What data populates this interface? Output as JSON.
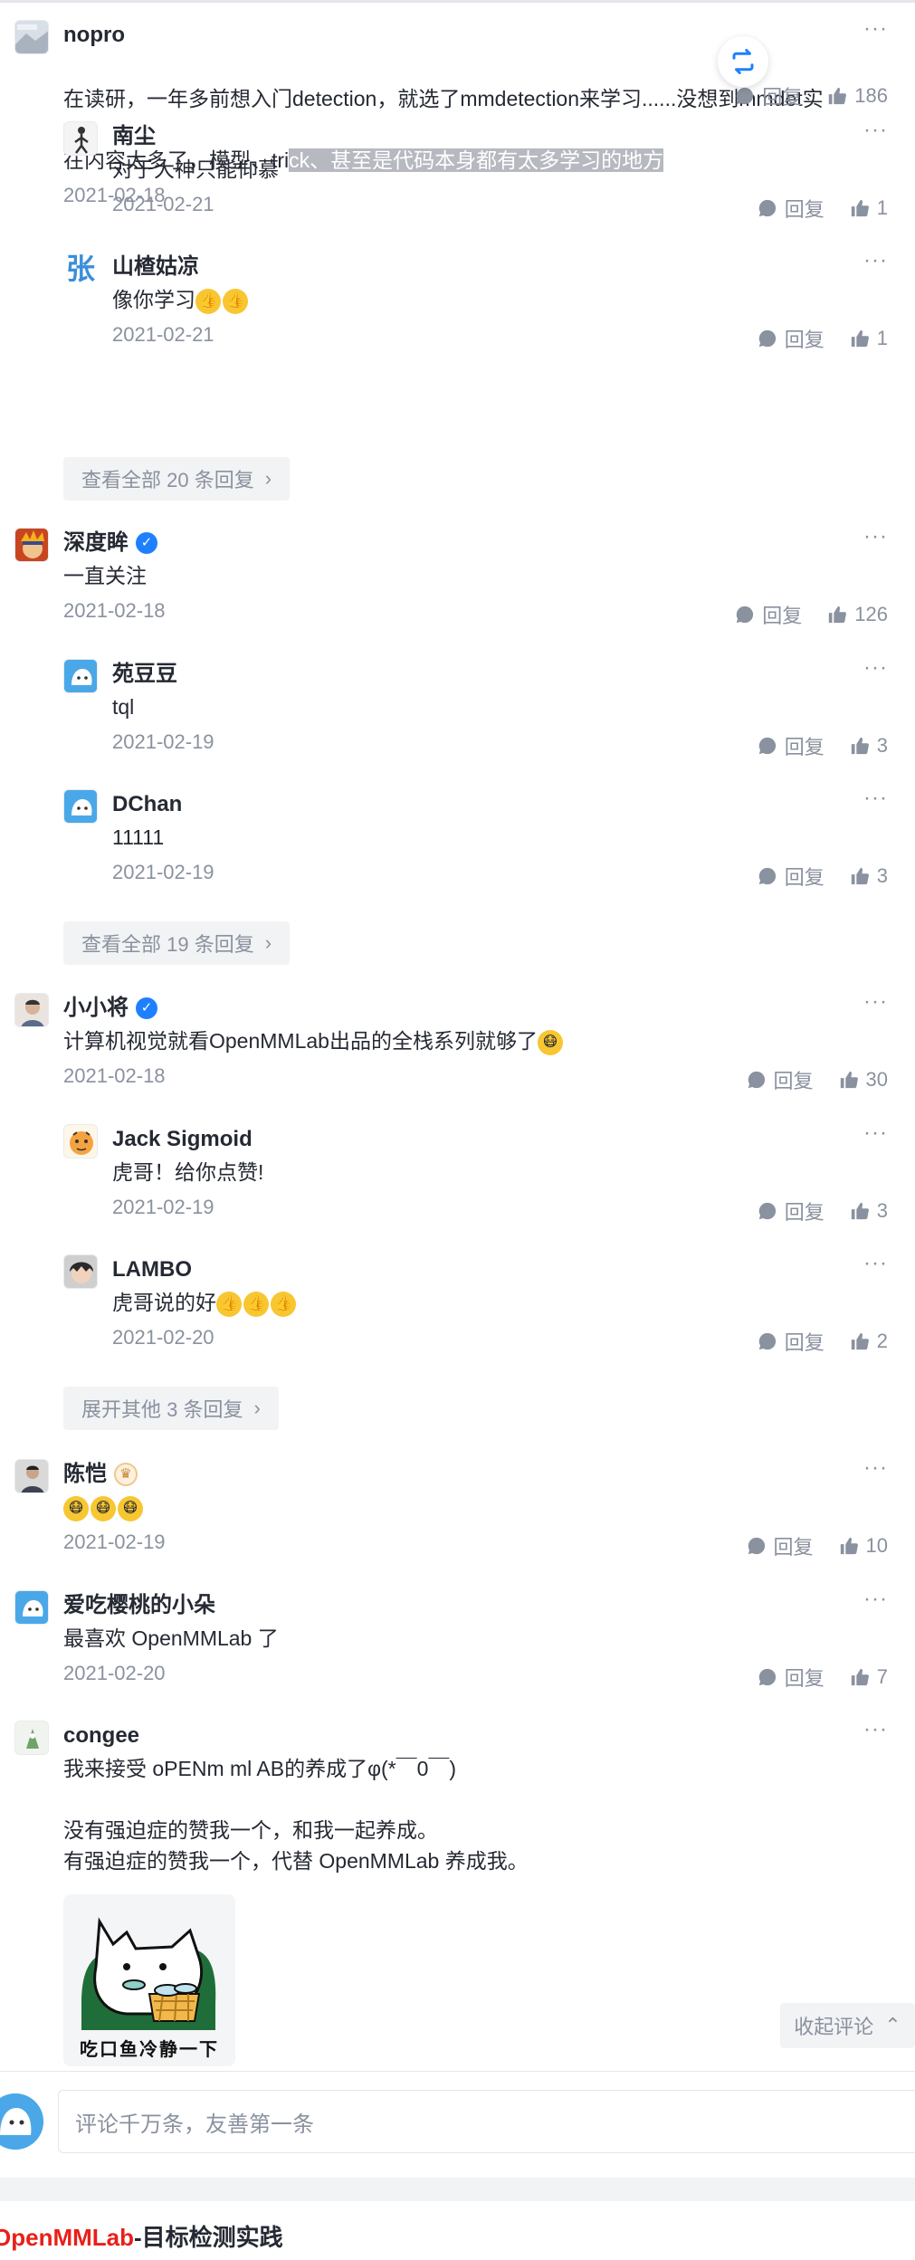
{
  "comments": [
    {
      "name": "nopro",
      "text_lines": [
        "在读研，一年多前想入门detection，就选了mmdetection来学习......没想到mmdet实",
        "在内容太多了，模型、tri"
      ],
      "text_selected": "ck、甚至是代码本身都有太多学习的地方",
      "date": "2021-02-18",
      "reply_label": "回复",
      "likes": "186"
    },
    {
      "name": "南尘",
      "text": "对于大神只能仰慕",
      "date": "2021-02-21",
      "reply_label": "回复",
      "likes": "1"
    },
    {
      "name": "山楂姑凉",
      "text": "像你学习",
      "avatar_text": "张",
      "date": "2021-02-21",
      "reply_label": "回复",
      "likes": "1"
    },
    {
      "name": "深度眸",
      "text": "一直关注",
      "date": "2021-02-18",
      "reply_label": "回复",
      "likes": "126"
    },
    {
      "name": "苑豆豆",
      "text": "tql",
      "date": "2021-02-19",
      "reply_label": "回复",
      "likes": "3"
    },
    {
      "name": "DChan",
      "text": "11111",
      "date": "2021-02-19",
      "reply_label": "回复",
      "likes": "3"
    },
    {
      "name": "小小将",
      "text": "计算机视觉就看OpenMMLab出品的全栈系列就够了",
      "date": "2021-02-18",
      "reply_label": "回复",
      "likes": "30"
    },
    {
      "name": "Jack Sigmoid",
      "text": "虎哥！给你点赞!",
      "date": "2021-02-19",
      "reply_label": "回复",
      "likes": "3"
    },
    {
      "name": "LAMBO",
      "text": "虎哥说的好",
      "date": "2021-02-20",
      "reply_label": "回复",
      "likes": "2"
    },
    {
      "name": "陈恺",
      "date": "2021-02-19",
      "reply_label": "回复",
      "likes": "10"
    },
    {
      "name": "爱吃樱桃的小朵",
      "text": "最喜欢 OpenMMLab 了",
      "date": "2021-02-20",
      "reply_label": "回复",
      "likes": "7"
    },
    {
      "name": "congee",
      "text": "我来接受 oPENm ml AB的养成了φ(*￣0￣)\n\n没有强迫症的赞我一个，和我一起养成。\n有强迫症的赞我一个，代替 OpenMMLab 养成我。"
    }
  ],
  "expand_buttons": [
    "查看全部 20 条回复",
    "查看全部 19 条回复",
    "展开其他 3 条回复"
  ],
  "sticker_caption": "吃口鱼冷静一下",
  "collapse_label": "收起评论",
  "input": {
    "placeholder": "评论千万条，友善第一条"
  },
  "next_article": {
    "title_red": "OpenMMLab",
    "title_rest": "-目标检测实践"
  },
  "colors": {
    "accent_blue": "#1e80ff",
    "muted": "#8a919f",
    "text": "#252933",
    "red": "#e8201a"
  }
}
